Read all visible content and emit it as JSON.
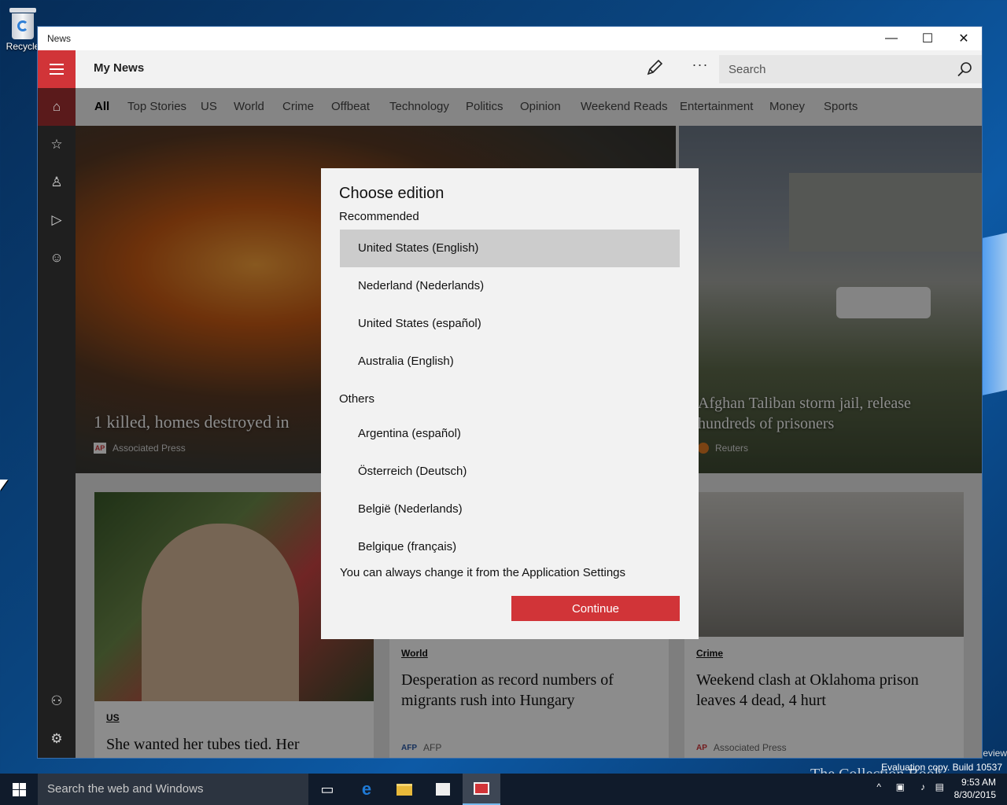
{
  "desktop": {
    "recycle_label": "Recycle",
    "build_text": "Evaluation copy. Build 10537",
    "preview_text": "eview",
    "watermark": "The Collection Book"
  },
  "window": {
    "title": "News",
    "controls": {
      "minimize": "—",
      "maximize": "☐",
      "close": "✕"
    }
  },
  "appbar": {
    "title": "My News",
    "more_label": "···",
    "search_placeholder": "Search"
  },
  "tabs": [
    "All",
    "Top Stories",
    "US",
    "World",
    "Crime",
    "Offbeat",
    "Technology",
    "Politics",
    "Opinion",
    "Weekend Reads",
    "Entertainment",
    "Money",
    "Sports"
  ],
  "sidebar": {
    "icons": [
      "home-icon",
      "star-list-icon",
      "person-icon",
      "play-icon",
      "smiley-icon",
      "add-user-icon",
      "gear-icon"
    ]
  },
  "hero": [
    {
      "title": "1 killed, homes destroyed in",
      "source": "Associated Press",
      "logo": "AP"
    },
    {
      "title": "Afghan Taliban storm jail, release hundreds of prisoners",
      "source": "Reuters"
    }
  ],
  "cards": [
    {
      "category": "US",
      "headline": "She wanted her tubes tied. Her",
      "source": ""
    },
    {
      "category": "World",
      "headline": "Desperation as record numbers of migrants rush into Hungary",
      "source": "AFP",
      "logo": "AFP"
    },
    {
      "category": "Crime",
      "headline": "Weekend clash at Oklahoma prison leaves 4 dead, 4 hurt",
      "source": "Associated Press",
      "logo": "AP"
    }
  ],
  "dialog": {
    "title": "Choose edition",
    "recommended_label": "Recommended",
    "others_label": "Others",
    "recommended": [
      "United States (English)",
      "Nederland (Nederlands)",
      "United States (español)",
      "Australia (English)"
    ],
    "others": [
      "Argentina (español)",
      "Österreich (Deutsch)",
      "België (Nederlands)",
      "Belgique (français)"
    ],
    "selected": "United States (English)",
    "note": "You can always change it from the Application Settings",
    "continue_label": "Continue"
  },
  "taskbar": {
    "search_placeholder": "Search the web and Windows",
    "time": "9:53 AM",
    "date": "8/30/2015"
  },
  "colors": {
    "accent": "#d13438",
    "sidebar": "#1f1f1f",
    "taskbar": "#101b2b"
  }
}
